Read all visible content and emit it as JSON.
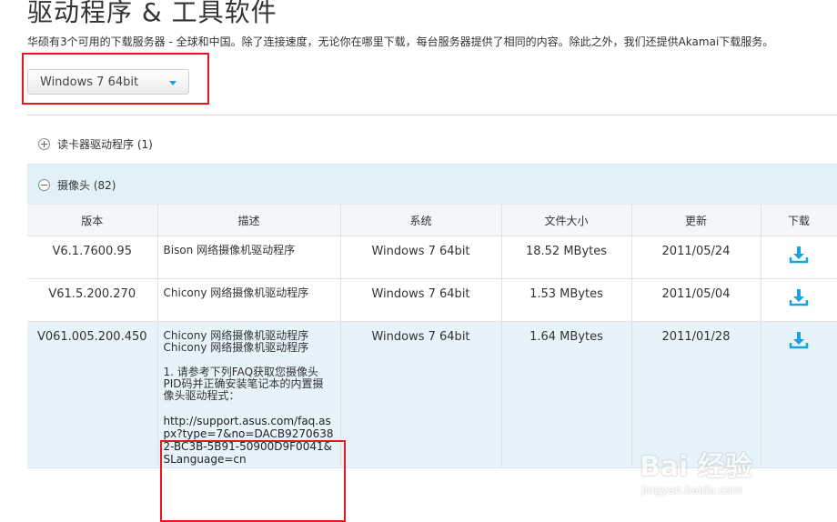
{
  "page": {
    "title": "驱动程序 & 工具软件",
    "intro": "华硕有3个可用的下载服务器 - 全球和中国。除了连接速度，无论你在哪里下载，每台服务器提供了相同的内容。除此之外，我们还提供Akamai下载服务。"
  },
  "os_select": {
    "value": "Windows 7 64bit"
  },
  "categories": [
    {
      "label": "读卡器驱动程序 (1)",
      "expanded": false
    },
    {
      "label": "摄像头 (82)",
      "expanded": true
    }
  ],
  "table": {
    "headers": [
      "版本",
      "描述",
      "系统",
      "文件大小",
      "更新",
      "下载"
    ],
    "rows": [
      {
        "version": "V6.1.7600.95",
        "description": "Bison 网络摄像机驱动程序",
        "os": "Windows 7 64bit",
        "size": "18.52 MBytes",
        "date": "2011/05/24"
      },
      {
        "version": "V61.5.200.270",
        "description": "Chicony 网络摄像机驱动程序",
        "os": "Windows 7 64bit",
        "size": "1.53 MBytes",
        "date": "2011/05/04"
      },
      {
        "version": "V061.005.200.450",
        "description": "Chicony 网络摄像机驱动程序",
        "description_repeat": "Chicony 网络摄像机驱动程序",
        "description_note": "1. 请参考下列FAQ获取您摄像头PID码并正确安装笔记本的内置摄像头驱动程式：",
        "description_url": "http://support.asus.com/faq.aspx?type=7&no=DACB92706382-BC3B-5B91-50900D9F0041&SLanguage=cn",
        "os": "Windows 7 64bit",
        "size": "1.64 MBytes",
        "date": "2011/01/28"
      }
    ]
  },
  "watermark": {
    "logo": "Bai 经验",
    "url": "jingyan.baidu.com"
  },
  "colors": {
    "accent": "#1aa1e0",
    "highlight_box": "#e8161e",
    "section_bg": "#e2f1f8"
  }
}
